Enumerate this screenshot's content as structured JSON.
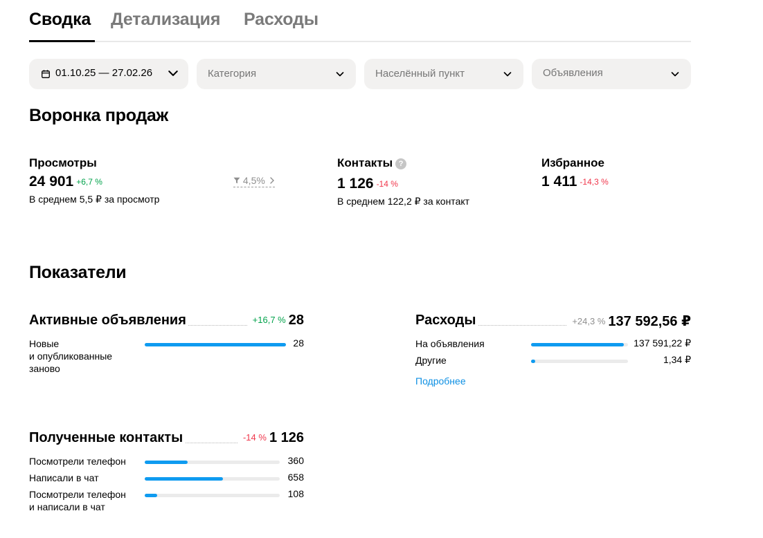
{
  "tabs": [
    {
      "label": "Сводка",
      "active": true
    },
    {
      "label": "Детализация",
      "active": false
    },
    {
      "label": "Расходы",
      "active": false
    }
  ],
  "filters": {
    "date": "01.10.25 — 27.02.26",
    "category": "Категория",
    "city": "Населённый пункт",
    "ads": "Объявления"
  },
  "funnel": {
    "title": "Воронка продаж",
    "views": {
      "label": "Просмотры",
      "value": "24 901",
      "change": "+6,7 %",
      "sub": "В среднем 5,5 ₽ за просмотр"
    },
    "conversion": "4,5%",
    "contacts": {
      "label": "Контакты",
      "value": "1 126",
      "change": "-14 %",
      "sub": "В среднем 122,2 ₽ за контакт",
      "help": "?"
    },
    "favorites": {
      "label": "Избранное",
      "value": "1 411",
      "change": "-14,3 %"
    }
  },
  "indicators": {
    "title": "Показатели",
    "active_ads": {
      "label": "Активные объявления",
      "change": "+16,7 %",
      "value": "28",
      "rows": [
        {
          "label": "Новые\nи опубликованные\nзаново",
          "value": "28",
          "fill": 1.0
        }
      ]
    },
    "expenses": {
      "label": "Расходы",
      "change": "+24,3 %",
      "value": "137 592,56 ₽",
      "rows": [
        {
          "label": "На объявления",
          "value": "137 591,22 ₽",
          "fill": 0.96
        },
        {
          "label": "Другие",
          "value": "1,34 ₽",
          "fill": 0.04
        }
      ],
      "link": "Подробнее"
    },
    "contacts": {
      "label": "Полученные контакты",
      "change": "-14 %",
      "value": "1 126",
      "rows": [
        {
          "label": "Посмотрели телефон",
          "value": "360",
          "fill": 0.32
        },
        {
          "label": "Написали в чат",
          "value": "658",
          "fill": 0.58
        },
        {
          "label": "Посмотрели телефон\nи написали в чат",
          "value": "108",
          "fill": 0.09
        }
      ]
    }
  },
  "colors": {
    "accent": "#0f9bf0",
    "positive": "#02a24b",
    "negative": "#f0364b"
  }
}
